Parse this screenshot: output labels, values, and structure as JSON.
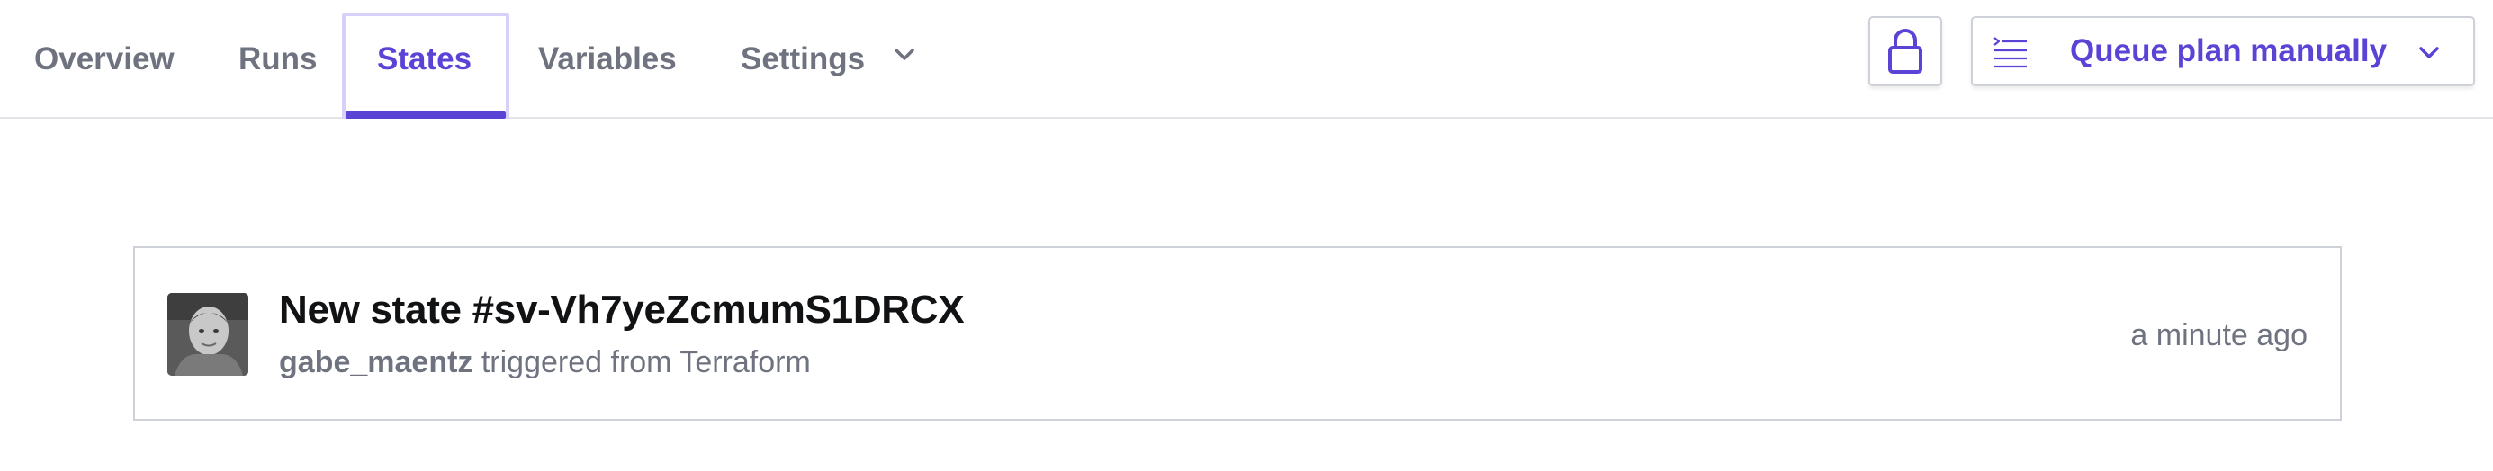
{
  "nav": {
    "tabs": [
      {
        "label": "Overview"
      },
      {
        "label": "Runs"
      },
      {
        "label": "States"
      },
      {
        "label": "Variables"
      },
      {
        "label": "Settings"
      }
    ],
    "active_tab": "States"
  },
  "actions": {
    "lock_icon": "lock-icon",
    "queue_plan_label": "Queue plan manually",
    "queue_plan_icon": "terminal-lines-icon"
  },
  "state_card": {
    "title": "New state #sv-Vh7yeZcmumS1DRCX",
    "user": "gabe_maentz",
    "trigger_text": "triggered from Terraform",
    "time": "a minute ago"
  },
  "colors": {
    "accent": "#5b43d6",
    "muted_text": "#6f7380",
    "border": "#cfd1d8"
  }
}
